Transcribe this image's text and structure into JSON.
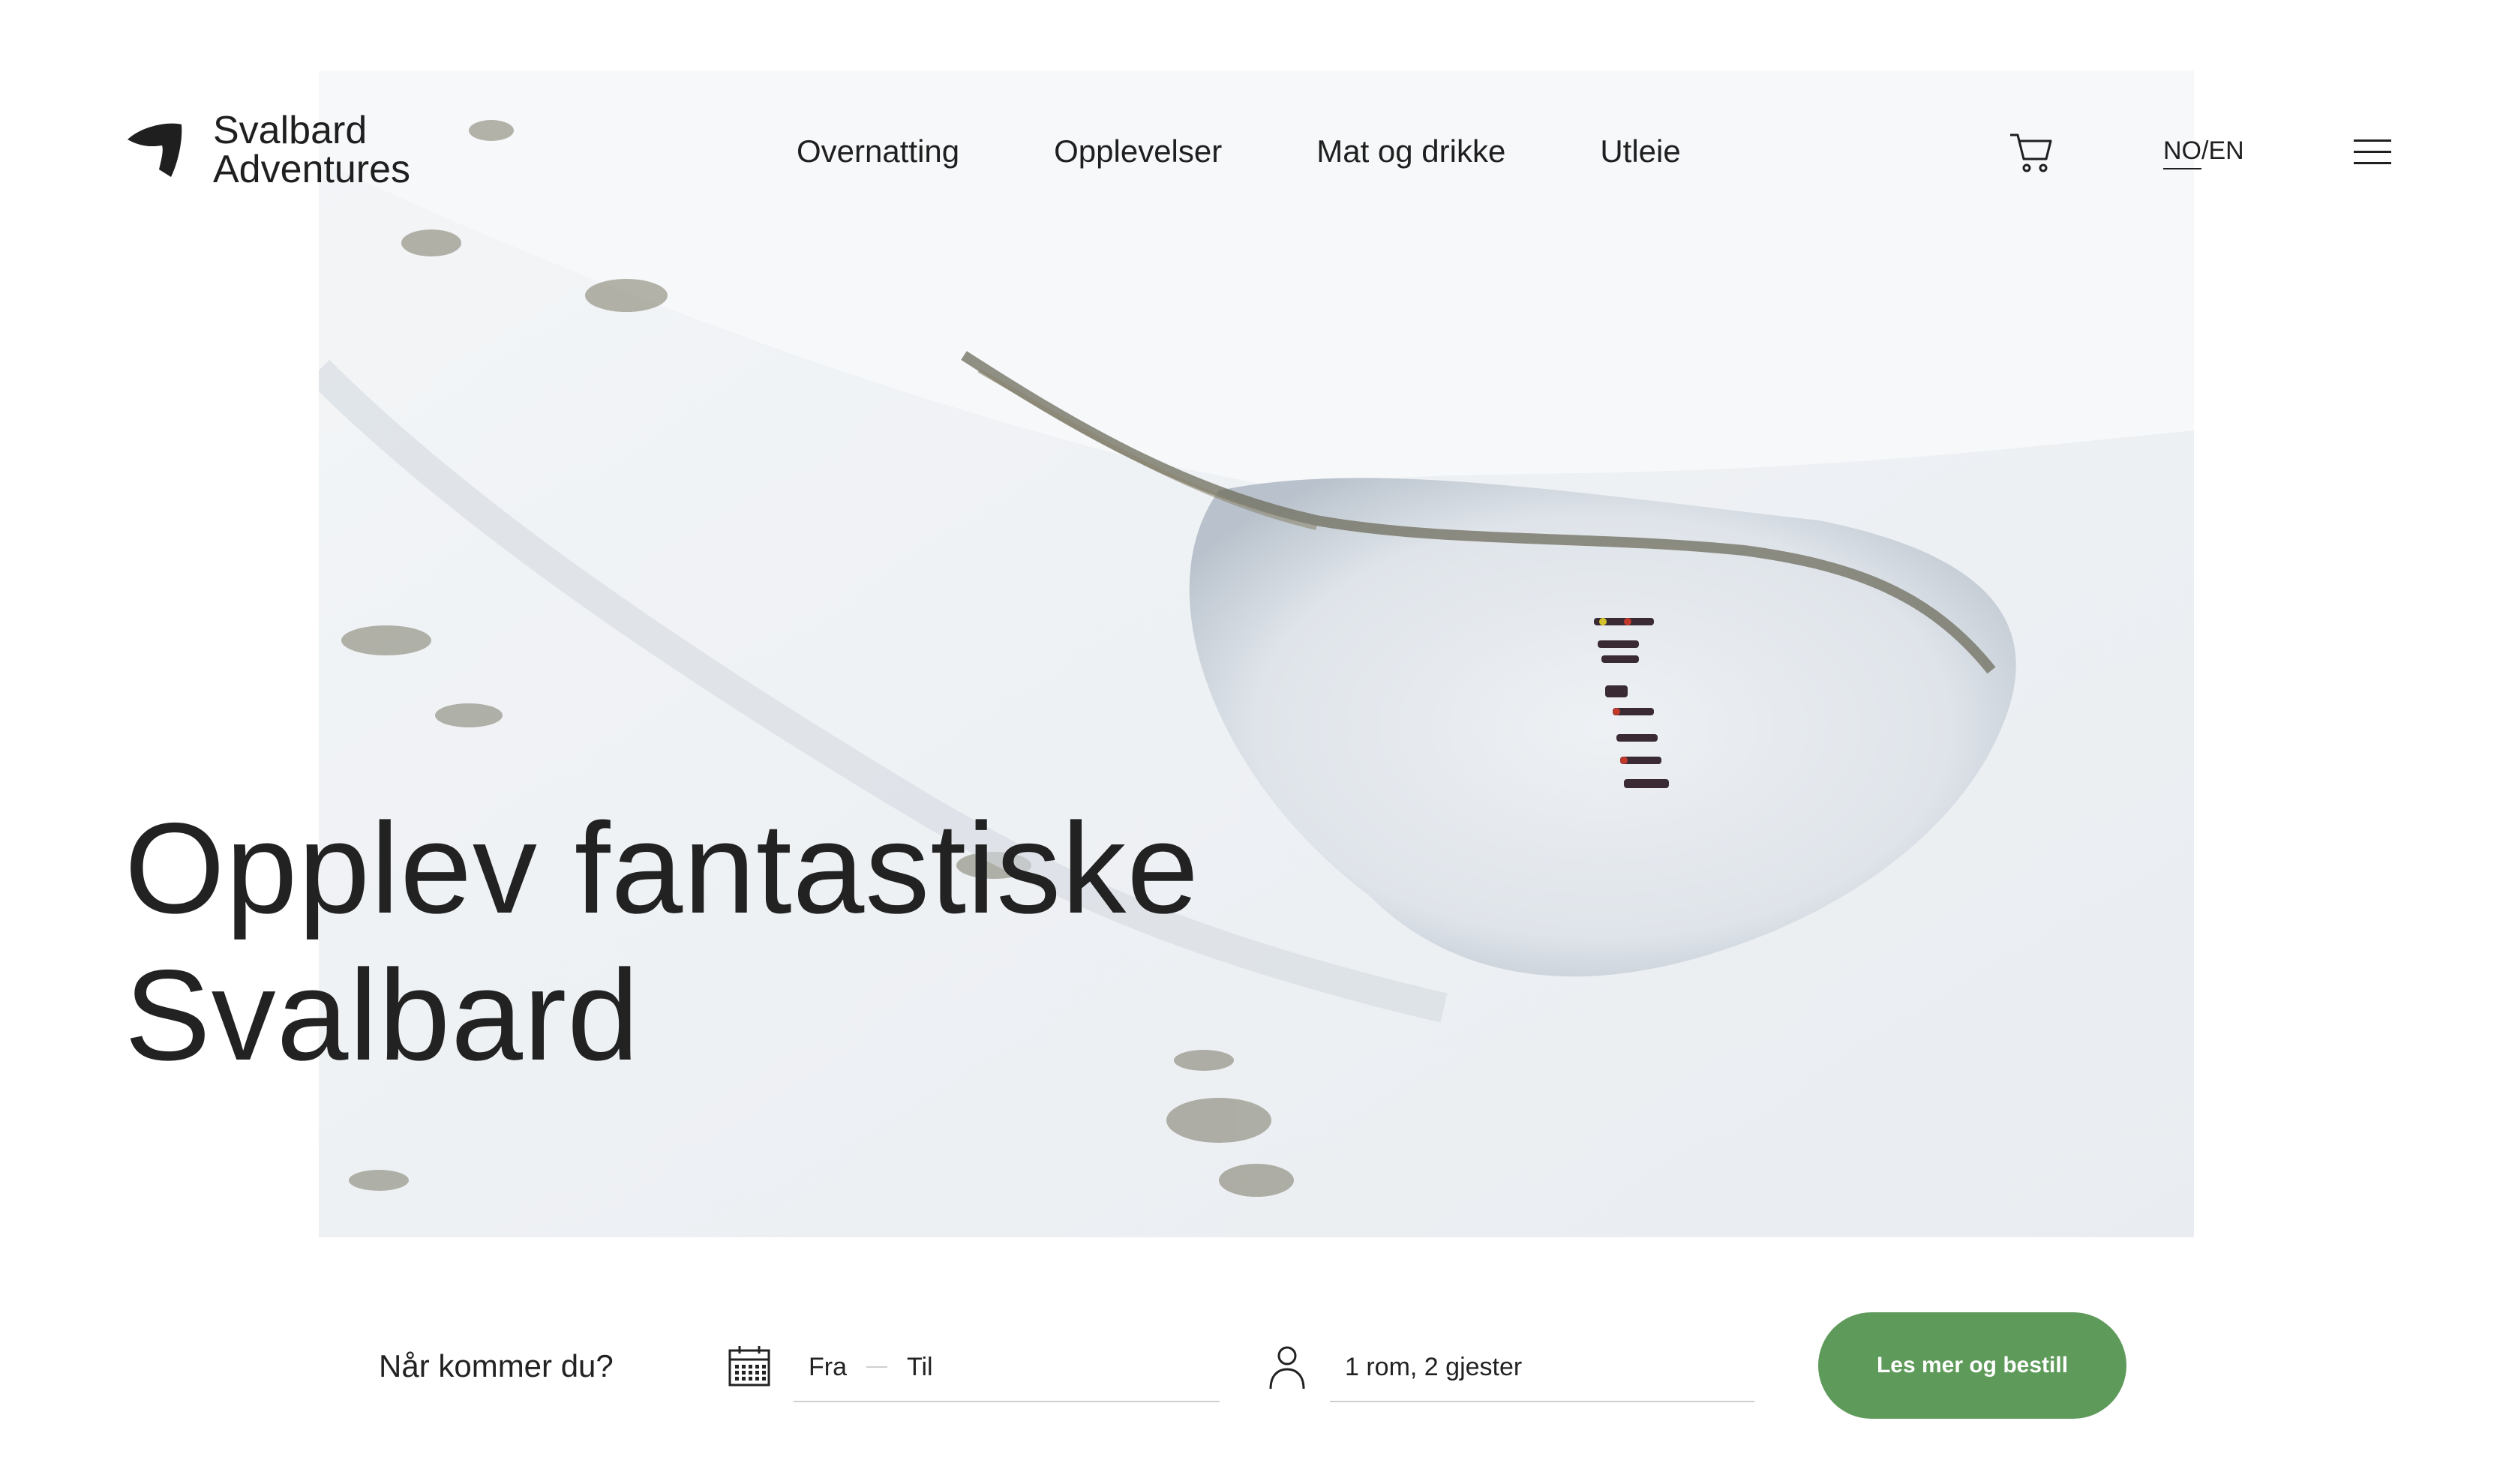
{
  "brand": {
    "line1": "Svalbard",
    "line2": "Adventures",
    "logo_icon": "arrow-logo-icon"
  },
  "nav": {
    "items": [
      {
        "label": "Overnatting"
      },
      {
        "label": "Opplevelser"
      },
      {
        "label": "Mat og drikke"
      },
      {
        "label": "Utleie"
      }
    ]
  },
  "header": {
    "cart_icon": "cart-icon",
    "lang_no": "NO",
    "lang_sep": "/",
    "lang_en": "EN",
    "menu_icon": "hamburger-menu-icon"
  },
  "hero": {
    "line1": "Opplev fantastiske",
    "line2": "Svalbard"
  },
  "booking": {
    "question": "Når kommer du?",
    "calendar_icon": "calendar-icon",
    "from_label": "Fra",
    "to_label": "Til",
    "person_icon": "person-icon",
    "guests_value": "1 rom, 2 gjester",
    "cta_label": "Les mer og bestill",
    "cta_color": "#5e9a5a"
  }
}
